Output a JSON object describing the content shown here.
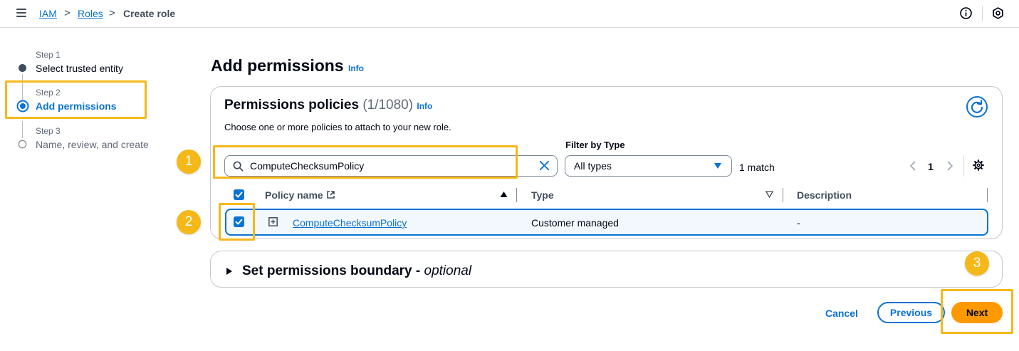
{
  "breadcrumb": {
    "items": [
      "IAM",
      "Roles"
    ],
    "current": "Create role",
    "separator": ">"
  },
  "steps": [
    {
      "label": "Step 1",
      "title": "Select trusted entity"
    },
    {
      "label": "Step 2",
      "title": "Add permissions"
    },
    {
      "label": "Step 3",
      "title": "Name, review, and create"
    }
  ],
  "main": {
    "title": "Add permissions",
    "info": "Info"
  },
  "policies": {
    "title": "Permissions policies",
    "count": "(1/1080)",
    "info": "Info",
    "description": "Choose one or more policies to attach to your new role.",
    "search_value": "ComputeChecksumPolicy",
    "filter_label": "Filter by Type",
    "filter_value": "All types",
    "match_count": "1 match",
    "page": "1",
    "columns": [
      "Policy name",
      "Type",
      "Description"
    ],
    "rows": [
      {
        "name": "ComputeChecksumPolicy",
        "type": "Customer managed",
        "description": "-"
      }
    ]
  },
  "boundary": {
    "title": "Set permissions boundary - ",
    "optional": "optional"
  },
  "buttons": {
    "cancel": "Cancel",
    "previous": "Previous",
    "next": "Next"
  },
  "annotations": [
    "1",
    "2",
    "3"
  ],
  "colors": {
    "accent": "#0972d3",
    "primary_button": "#ff9900",
    "highlight": "#f5b819"
  }
}
